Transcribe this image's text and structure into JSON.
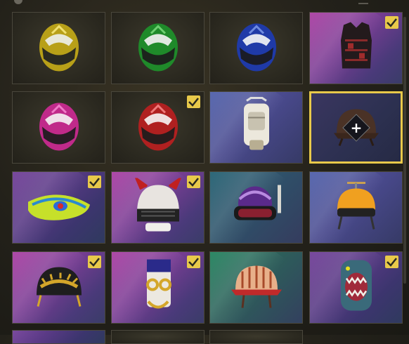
{
  "inventory": {
    "items": [
      {
        "name": "yellow-motorcycle-helmet",
        "owned": false
      },
      {
        "name": "green-motorcycle-helmet",
        "owned": false
      },
      {
        "name": "blue-motorcycle-helmet",
        "owned": false
      },
      {
        "name": "black-red-vest",
        "owned": true
      },
      {
        "name": "pink-motorcycle-helmet",
        "owned": false
      },
      {
        "name": "red-motorcycle-helmet",
        "owned": true
      },
      {
        "name": "white-backpack",
        "owned": false
      },
      {
        "name": "brown-helmet",
        "owned": false,
        "selected": true
      },
      {
        "name": "green-bandana-hat",
        "owned": true
      },
      {
        "name": "demon-horn-helmet",
        "owned": true
      },
      {
        "name": "purple-dome-helmet",
        "owned": false
      },
      {
        "name": "orange-propeller-helmet",
        "owned": false
      },
      {
        "name": "black-gold-laurel-helmet",
        "owned": true
      },
      {
        "name": "gold-goggles-backpack",
        "owned": true
      },
      {
        "name": "orange-striped-helmet",
        "owned": false
      },
      {
        "name": "shark-mouth-backpack",
        "owned": true
      }
    ],
    "add_symbol": "+"
  },
  "colors": {
    "accent": "#e8c94a",
    "background": "#23211a"
  }
}
